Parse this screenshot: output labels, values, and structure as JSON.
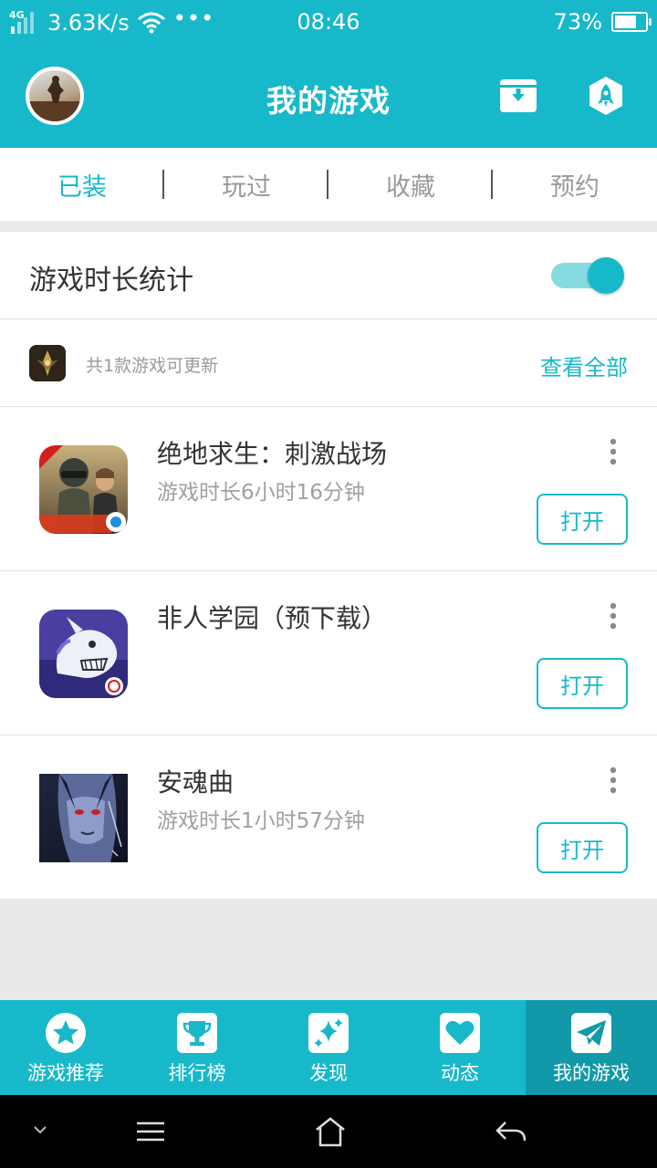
{
  "status_bar": {
    "network": "4G",
    "speed": "3.63K/s",
    "more": "•••",
    "time": "08:46",
    "battery_percent": "73%",
    "battery_level": 0.73
  },
  "header": {
    "title": "我的游戏",
    "avatar_icon": "avatar",
    "actions": [
      "download-box-icon",
      "rocket-icon"
    ]
  },
  "tabs": [
    {
      "label": "已装",
      "active": true
    },
    {
      "label": "玩过",
      "active": false
    },
    {
      "label": "收藏",
      "active": false
    },
    {
      "label": "预约",
      "active": false
    }
  ],
  "stats": {
    "label": "游戏时长统计",
    "enabled": true
  },
  "updates": {
    "text": "共1款游戏可更新",
    "view_all": "查看全部"
  },
  "games": [
    {
      "name": "绝地求生：刺激战场",
      "playtime": "游戏时长6小时16分钟",
      "action": "打开",
      "badge": "正版",
      "banner": "天降奇兵"
    },
    {
      "name": "非人学园（预下载）",
      "playtime": "",
      "action": "打开"
    },
    {
      "name": "安魂曲",
      "playtime": "游戏时长1小时57分钟",
      "action": "打开"
    }
  ],
  "bottom_nav": [
    {
      "label": "游戏推荐",
      "icon": "star-icon",
      "active": false
    },
    {
      "label": "排行榜",
      "icon": "trophy-icon",
      "active": false
    },
    {
      "label": "发现",
      "icon": "sparkle-icon",
      "active": false
    },
    {
      "label": "动态",
      "icon": "heart-icon",
      "active": false
    },
    {
      "label": "我的游戏",
      "icon": "paper-plane-icon",
      "active": true
    }
  ],
  "system_nav": [
    "chevron-down-icon",
    "menu-icon",
    "home-icon",
    "back-icon"
  ],
  "colors": {
    "accent": "#17b8c9",
    "accent_dark": "#1199a9",
    "text": "#333333",
    "muted": "#9a9a9a",
    "background": "#e9e9e9"
  }
}
